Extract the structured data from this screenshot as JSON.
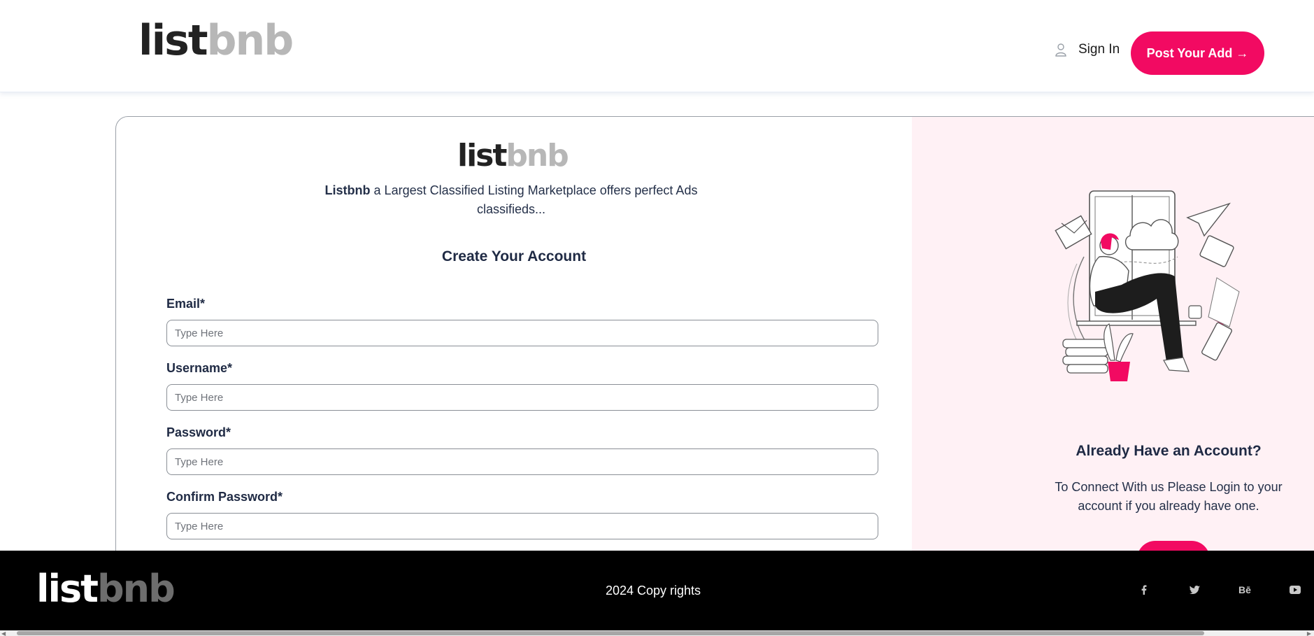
{
  "brand": {
    "dark": "list",
    "light": "bnb"
  },
  "header": {
    "signin_label": "Sign In",
    "post_label": "Post Your Add →"
  },
  "intro": {
    "brand_name": "Listbnb",
    "tagline_rest": " a Largest Classified Listing Marketplace offers perfect Ads classifieds..."
  },
  "form": {
    "title": "Create Your Account",
    "fields": [
      {
        "label": "Email*",
        "placeholder": "Type Here",
        "value": ""
      },
      {
        "label": "Username*",
        "placeholder": "Type Here",
        "value": ""
      },
      {
        "label": "Password*",
        "placeholder": "Type Here",
        "value": ""
      },
      {
        "label": "Confirm Password*",
        "placeholder": "Type Here",
        "value": ""
      }
    ]
  },
  "side": {
    "title": "Already Have an Account?",
    "text": "To Connect With us Please Login to your account if you already have one."
  },
  "footer": {
    "copyright": "2024 Copy rights",
    "socials": [
      "facebook-icon",
      "twitter-icon",
      "behance-icon",
      "youtube-icon"
    ]
  },
  "colors": {
    "accent": "#f20a62",
    "side_bg": "#fff1f5",
    "footer_bg": "#000000"
  }
}
